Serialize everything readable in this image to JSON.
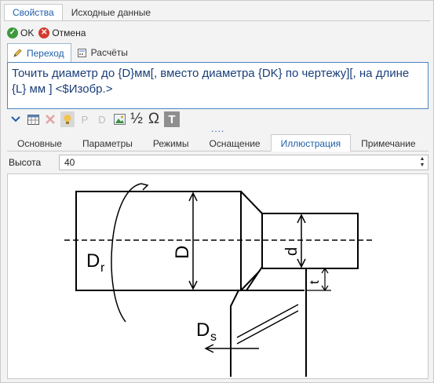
{
  "top_tabs": [
    {
      "label": "Свойства"
    },
    {
      "label": "Исходные данные"
    }
  ],
  "actions": {
    "ok": "OK",
    "cancel": "Отмена"
  },
  "sub_tabs": [
    {
      "label": "Переход"
    },
    {
      "label": "Расчёты"
    }
  ],
  "formula": "Точить диаметр до {D}мм[, вместо диаметра {DK} по чертежу][, на длине {L} мм ] <$Изобр.>",
  "toolbar": {
    "p_label": "P",
    "d_label": "D",
    "half_label": "½",
    "omega_label": "Ω",
    "t_label": "T",
    "more_dots": "...."
  },
  "section_tabs": [
    {
      "label": "Основные"
    },
    {
      "label": "Параметры"
    },
    {
      "label": "Режимы"
    },
    {
      "label": "Оснащение"
    },
    {
      "label": "Иллюстрация"
    },
    {
      "label": "Примечание"
    }
  ],
  "height": {
    "label": "Высота",
    "value": "40"
  },
  "drawing": {
    "label_dr": "D",
    "label_dr_sub": "r",
    "label_d_big": "D",
    "label_d_small": "d",
    "label_t": "t",
    "label_ds": "D",
    "label_ds_sub": "s"
  },
  "colors": {
    "accent": "#1f5fa8",
    "ok": "#3c9a3c",
    "cancel": "#d43b2f"
  }
}
